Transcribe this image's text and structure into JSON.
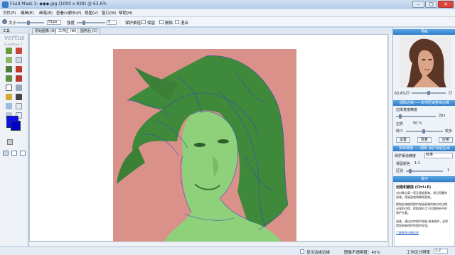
{
  "window": {
    "title": "Fluid Mask 3: ◆◆◆.jpg (1000 x 938) @ 63.6%"
  },
  "menu": [
    "文件(F)",
    "编辑(E)",
    "画笔(B)",
    "查看(V)",
    "修补(P)",
    "视图(V)",
    "窗口(W)",
    "帮助(H)"
  ],
  "toolbar": {
    "size_label": "大小",
    "size_value": "51px",
    "strength_label": "强度",
    "strength_value": "5",
    "protect_label": "保护渠道:",
    "options": [
      "保留",
      "删除",
      "混合"
    ]
  },
  "left": {
    "tools_title": "工具",
    "brand_line1": "vertus",
    "brand_line2": "Fluid Mask 3",
    "color_fg": "#0a10f0",
    "color_bg": "#0000c8"
  },
  "tabs": [
    "原始图像 (O)",
    "工作区 (W)",
    "图形后 (C)"
  ],
  "active_tab": 1,
  "right": {
    "nav_title": "导航",
    "zoom_value": "63.6%",
    "edge_title": "提取边缘——本地区域整体边缘",
    "edge_label": "边缘宽度精度",
    "edge_value": "2px",
    "detail_label": "边界",
    "detail_value": "50 %",
    "left_label": "较少",
    "right_label": "较多",
    "reset_button": "设置",
    "default_button": "恢复",
    "apply_button": "应用",
    "object_title": "物体精度——限制 保护保留区域",
    "mode_label": "保护渠道精度",
    "mode_value": "标准",
    "ratio_label": "保留颜色",
    "ratio_value": "1:1",
    "diff_label": "区别",
    "diff_value": "1",
    "tips_title": "提示",
    "tip_heading": "创建和删除 (Ctrl+E)",
    "tip_lines": [
      "对对象分离一项无保留画笔，然后再删除",
      "画笔。保留画笔和删除画笔。",
      "提取区域使用保护保留画笔的地方的边缘，",
      "无保护边缘，帮助保护之下后期修补中的",
      "保护元素。",
      "",
      "画笔，通过在你保护保留 线来保护，这样",
      "就容易来保护你保护区域。"
    ],
    "tip_link": "了解更多详细信息"
  },
  "status": {
    "show_edges_label": "显示边缘边缘",
    "progress_label": "图像不透明度：45%",
    "zoom_label": "工作区分辨率",
    "zoom_value": "1:2"
  }
}
